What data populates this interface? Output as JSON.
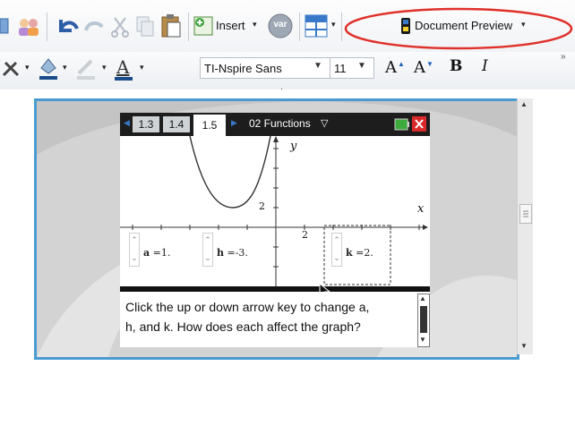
{
  "toolbar_top": {
    "insert_label": "Insert",
    "var_label": "var",
    "document_preview_label": "Document Preview",
    "colors": {
      "highlight_ellipse": "#e0302a",
      "doc_icon": "#1a1a1a"
    }
  },
  "toolbar_format": {
    "font_name": "TI-Nspire Sans",
    "font_size": "11",
    "bold_label": "B",
    "italic_label": "I",
    "font_color_label": "A",
    "grow_font_label": "A",
    "shrink_font_label": "A",
    "overflow_label": "»"
  },
  "calculator": {
    "tabs": [
      {
        "label": "1.3",
        "active": false
      },
      {
        "label": "1.4",
        "active": false
      },
      {
        "label": "1.5",
        "active": true
      }
    ],
    "document_title": "02 Functions",
    "graph": {
      "y_axis_label": "y",
      "x_axis_label": "x",
      "y_tick_label": "2",
      "x_tick_label": "2",
      "sliders": [
        {
          "var": "a",
          "value": "1."
        },
        {
          "var": "h",
          "value": "-3."
        },
        {
          "var": "k",
          "value": "2."
        }
      ]
    },
    "notes": {
      "line1": "Click the up or down arrow key to change a,",
      "line2": "h, and k. How does each affect the graph?"
    }
  },
  "colors": {
    "accent_frame": "#4a9bd1",
    "calc_header": "#1d1d1d",
    "close_button": "#d9292b",
    "battery_icon": "#3caa3c"
  }
}
